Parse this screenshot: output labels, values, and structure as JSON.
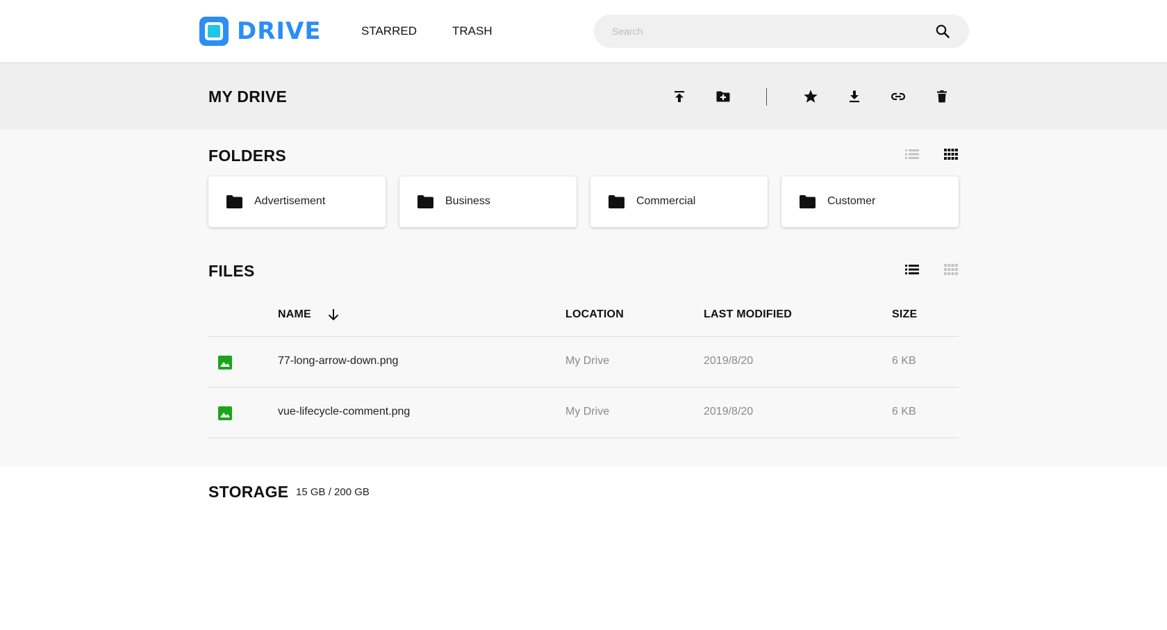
{
  "header": {
    "logo_text": "DRIVE",
    "nav": {
      "starred": "STARRED",
      "trash": "TRASH"
    },
    "search": {
      "placeholder": "Search",
      "value": ""
    },
    "brand_color": "#2b8ef3",
    "icons": {
      "logo": "drive-logo-icon",
      "search": "search-icon"
    }
  },
  "toolbar": {
    "title": "MY DRIVE",
    "actions": [
      "upload-icon",
      "new-folder-icon",
      "star-icon",
      "download-icon",
      "link-icon",
      "trash-icon"
    ]
  },
  "folders": {
    "title": "FOLDERS",
    "view": "grid",
    "items": [
      {
        "name": "Advertisement"
      },
      {
        "name": "Business"
      },
      {
        "name": "Commercial"
      },
      {
        "name": "Customer"
      }
    ]
  },
  "files": {
    "title": "FILES",
    "view": "list",
    "sort": {
      "column": "name",
      "direction": "descending"
    },
    "columns": {
      "name": "NAME",
      "location": "LOCATION",
      "modified": "LAST MODIFIED",
      "size": "SIZE"
    },
    "rows": [
      {
        "name": "77-long-arrow-down.png",
        "location": "My Drive",
        "modified": "2019/8/20",
        "size": "6 KB",
        "icon": "image-file-icon"
      },
      {
        "name": "vue-lifecycle-comment.png",
        "location": "My Drive",
        "modified": "2019/8/20",
        "size": "6 KB",
        "icon": "image-file-icon"
      }
    ],
    "image_icon_color": "#1aa61a"
  },
  "storage": {
    "title": "STORAGE",
    "value": "15 GB / 200 GB"
  }
}
